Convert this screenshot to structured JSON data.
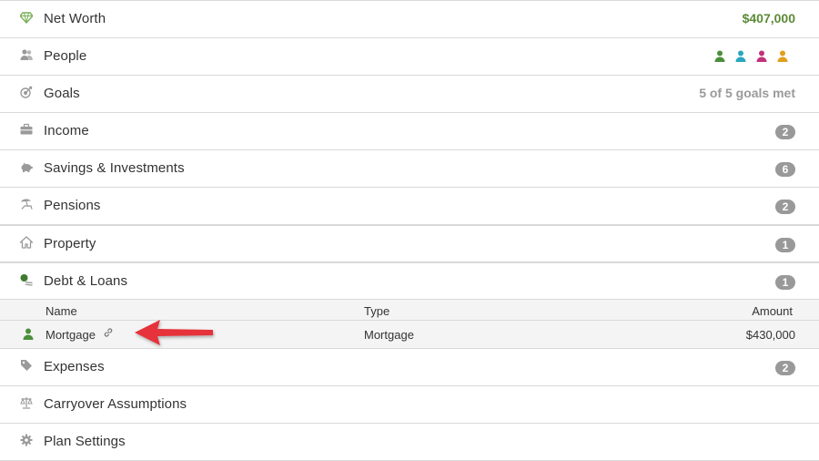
{
  "rows": {
    "net_worth": {
      "label": "Net Worth",
      "value": "$407,000",
      "value_color": "#5b8a36",
      "icon": "diamond-icon"
    },
    "people": {
      "label": "People",
      "icon": "people-icon",
      "person_colors": [
        "#4b8f3b",
        "#2aa6bf",
        "#c2317a",
        "#e0a01e"
      ]
    },
    "goals": {
      "label": "Goals",
      "value": "5 of 5 goals met",
      "icon": "target-icon"
    },
    "income": {
      "label": "Income",
      "count": "2",
      "icon": "briefcase-icon"
    },
    "savings": {
      "label": "Savings & Investments",
      "count": "6",
      "icon": "piggy-bank-icon"
    },
    "pensions": {
      "label": "Pensions",
      "count": "2",
      "icon": "beach-chair-icon"
    },
    "property": {
      "label": "Property",
      "count": "1",
      "icon": "house-icon"
    },
    "debt": {
      "label": "Debt & Loans",
      "count": "1",
      "icon": "money-icon",
      "table": {
        "columns": {
          "name": "Name",
          "type": "Type",
          "amount": "Amount"
        },
        "rows": [
          {
            "name": "Mortgage",
            "type": "Mortgage",
            "amount": "$430,000",
            "owner_color": "#4b8f3b"
          }
        ]
      }
    },
    "expenses": {
      "label": "Expenses",
      "count": "2",
      "icon": "tag-icon"
    },
    "carryover": {
      "label": "Carryover Assumptions",
      "icon": "scales-icon"
    },
    "plan_settings": {
      "label": "Plan Settings",
      "icon": "gear-icon"
    }
  },
  "colors": {
    "icon_gray": "#9a9a9a",
    "badge_gray": "#999999",
    "divider": "#d9d9d9",
    "arrow_red": "#e5323a"
  }
}
